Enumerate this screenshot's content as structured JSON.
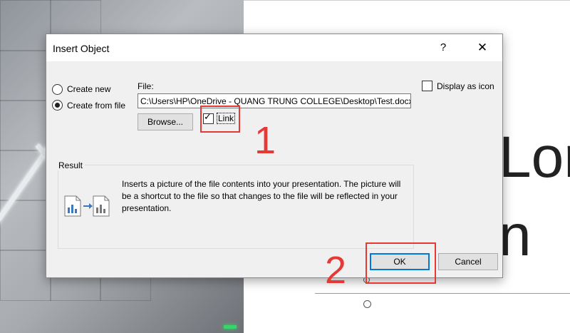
{
  "background": {
    "slide_text_1": "Lor",
    "slide_text_2": "n"
  },
  "dialog": {
    "title": "Insert Object",
    "help_label": "?",
    "close_label": "✕",
    "create_new_label": "Create new",
    "create_new_selected": false,
    "create_from_file_label": "Create from file",
    "create_from_file_selected": true,
    "file_label": "File:",
    "file_value": "C:\\Users\\HP\\OneDrive - QUANG TRUNG COLLEGE\\Desktop\\Test.docx",
    "browse_label": "Browse...",
    "link_label": "Link",
    "link_checked": true,
    "display_as_icon_label": "Display as icon",
    "display_as_icon_checked": false,
    "result_title": "Result",
    "result_text": "Inserts a picture of the file contents into your presentation. The picture will be a shortcut to the file so that changes to the file will be reflected in your presentation.",
    "ok_label": "OK",
    "cancel_label": "Cancel"
  },
  "annotations": {
    "step_1": "1",
    "step_2": "2",
    "color": "#e53935"
  },
  "icons": {
    "result_icon": "file-link-to-file-icon"
  }
}
